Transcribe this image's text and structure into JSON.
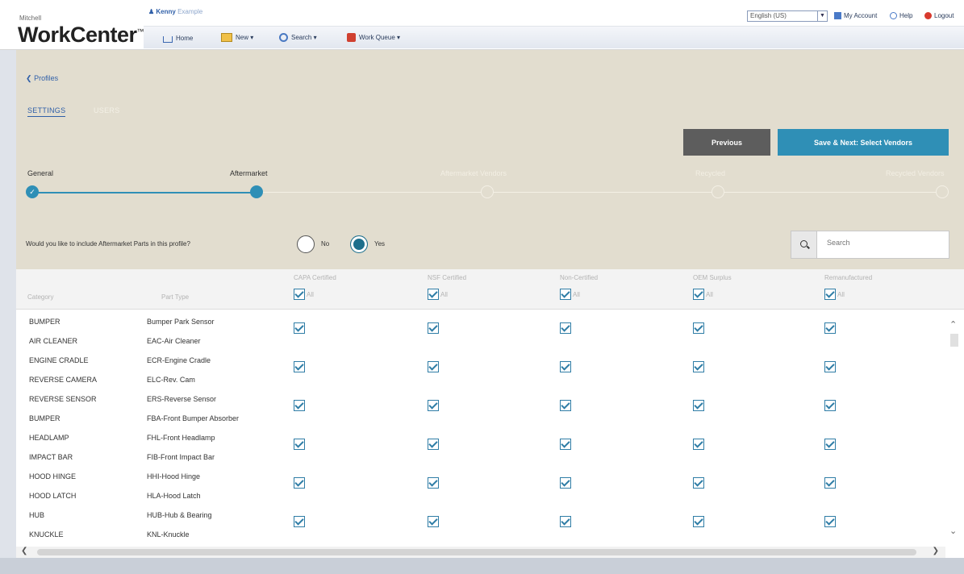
{
  "header": {
    "brand_small": "Mitchell",
    "brand": "WorkCenter",
    "brand_mark": "™",
    "user_first": "Kenny",
    "user_last": "Example",
    "nav": [
      {
        "label": "Home",
        "icon": "home-icon"
      },
      {
        "label": "New ▾",
        "icon": "new-icon"
      },
      {
        "label": "Search ▾",
        "icon": "search-icon"
      },
      {
        "label": "Work Queue ▾",
        "icon": "work-queue-icon"
      }
    ],
    "language": "English (US)",
    "language_arrow": "▼",
    "my_account": "My Account",
    "help": "Help",
    "logout": "Logout"
  },
  "wizard": {
    "back_label": "Profiles",
    "back_arrow": "❮",
    "tabs": [
      "SETTINGS",
      "USERS"
    ],
    "previous_label": "Previous",
    "save_next_label": "Save & Next: Select Vendors",
    "steps": [
      {
        "label": "General",
        "state": "done"
      },
      {
        "label": "Aftermarket",
        "state": "current"
      },
      {
        "label": "Aftermarket Vendors",
        "state": "todo"
      },
      {
        "label": "Recycled",
        "state": "todo"
      },
      {
        "label": "Recycled Vendors",
        "state": "todo"
      }
    ],
    "question": "Would you like to include Aftermarket Parts in this profile?",
    "no_label": "No",
    "yes_label": "Yes",
    "selected": "Yes",
    "search_placeholder": "Search",
    "done_check": "✓"
  },
  "table": {
    "col_category": "Category",
    "col_part_type": "Part Type",
    "cert_columns": [
      "CAPA Certified",
      "NSF Certified",
      "Non-Certified",
      "OEM Surplus",
      "Remanufactured"
    ],
    "all_label": "All",
    "rows": [
      {
        "category": "BUMPER",
        "part_type": "Bumper Park Sensor",
        "checked": true
      },
      {
        "category": "AIR CLEANER",
        "part_type": "EAC-Air Cleaner",
        "checked": false
      },
      {
        "category": "ENGINE CRADLE",
        "part_type": "ECR-Engine Cradle",
        "checked": true
      },
      {
        "category": "REVERSE CAMERA",
        "part_type": "ELC-Rev. Cam",
        "checked": false
      },
      {
        "category": "REVERSE SENSOR",
        "part_type": "ERS-Reverse Sensor",
        "checked": true
      },
      {
        "category": "BUMPER",
        "part_type": "FBA-Front Bumper Absorber",
        "checked": false
      },
      {
        "category": "HEADLAMP",
        "part_type": "FHL-Front Headlamp",
        "checked": true
      },
      {
        "category": "IMPACT BAR",
        "part_type": "FIB-Front Impact Bar",
        "checked": false
      },
      {
        "category": "HOOD HINGE",
        "part_type": "HHI-Hood Hinge",
        "checked": true
      },
      {
        "category": "HOOD LATCH",
        "part_type": "HLA-Hood Latch",
        "checked": false
      },
      {
        "category": "HUB",
        "part_type": "HUB-Hub & Bearing",
        "checked": true
      },
      {
        "category": "KNUCKLE",
        "part_type": "KNL-Knuckle",
        "checked": false
      }
    ]
  },
  "scroll": {
    "up": "⌃",
    "down": "⌄",
    "left": "❮",
    "right": "❯"
  },
  "colors": {
    "accent": "#2f8fb6",
    "panel": "#e2ddcf",
    "previous": "#5d5d5d"
  }
}
